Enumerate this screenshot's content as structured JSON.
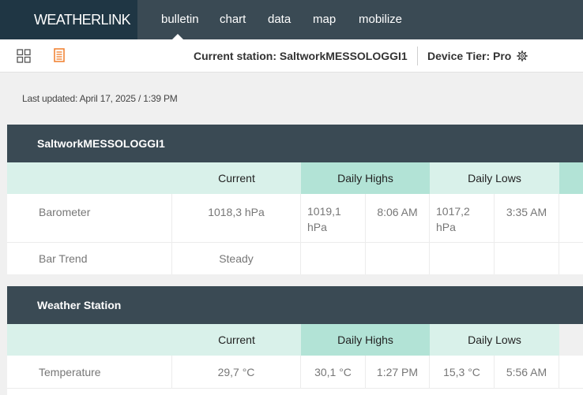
{
  "brand": "WEATHERLINK",
  "nav": [
    "bulletin",
    "chart",
    "data",
    "map",
    "mobilize"
  ],
  "toolbar": {
    "current_station": "Current station: SaltworkMESSOLOGGI1",
    "device_tier": "Device Tier: Pro"
  },
  "last_updated": "Last updated: April 17, 2025 / 1:39 PM",
  "columns": {
    "current": "Current",
    "daily_highs": "Daily Highs",
    "daily_lows": "Daily Lows"
  },
  "sections": [
    {
      "title": "SaltworkMESSOLOGGI1",
      "rows": [
        {
          "label": "Barometer",
          "current": "1018,3 hPa",
          "high_value": "1019,1 hPa",
          "high_time": "8:06 AM",
          "low_value": "1017,2 hPa",
          "low_time": "3:35 AM"
        },
        {
          "label": "Bar Trend",
          "current": "Steady",
          "high_value": "",
          "high_time": "",
          "low_value": "",
          "low_time": ""
        }
      ]
    },
    {
      "title": "Weather Station",
      "rows": [
        {
          "label": "Temperature",
          "current": "29,7 °C",
          "high_value": "30,1 °C",
          "high_time": "1:27 PM",
          "low_value": "15,3 °C",
          "low_time": "5:56 AM"
        }
      ]
    }
  ],
  "colors": {
    "nav_bg": "#3a4a54",
    "brand_bg": "#1f3644",
    "header_light": "#d9f1ea",
    "header_dark": "#b2e3d6",
    "accent_orange": "#f07d2a"
  },
  "icons": [
    "grid-view-icon",
    "bulletin-icon",
    "gear-icon"
  ]
}
